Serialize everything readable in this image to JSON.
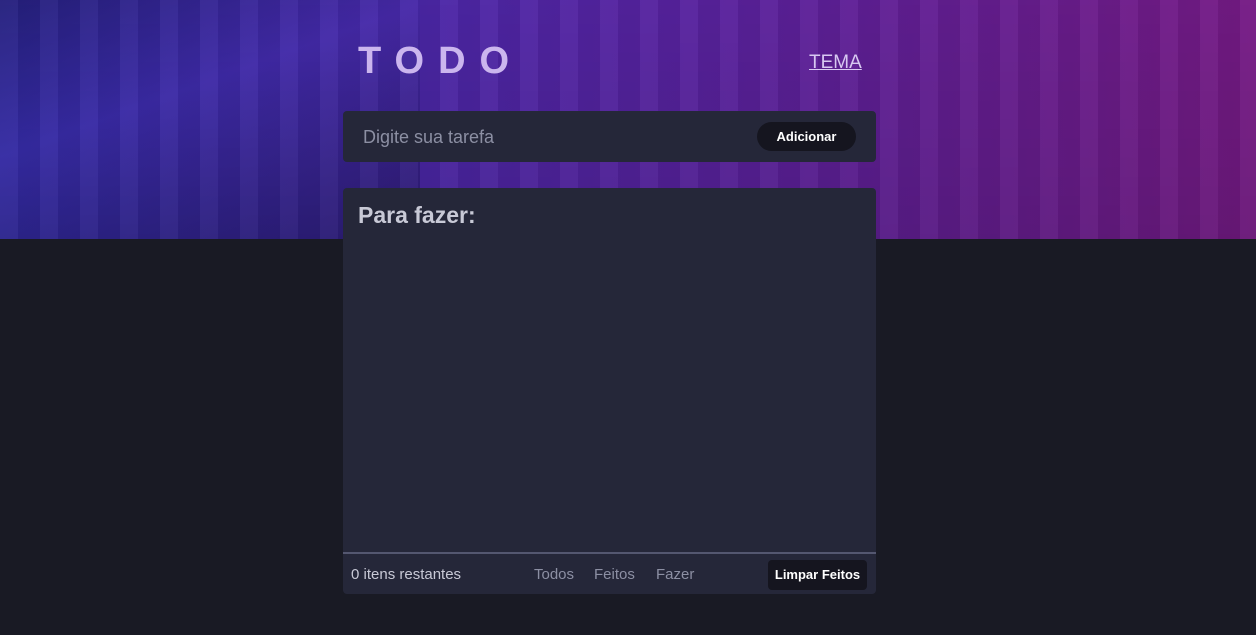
{
  "header": {
    "title": "TODO",
    "theme_link": "TEMA"
  },
  "new_task": {
    "placeholder": "Digite sua tarefa",
    "value": "",
    "add_label": "Adicionar"
  },
  "list": {
    "heading": "Para fazer:",
    "items": []
  },
  "footer": {
    "items_left": "0 itens restantes",
    "filters": [
      "Todos",
      "Feitos",
      "Fazer"
    ],
    "clear_label": "Limpar Feitos"
  },
  "colors": {
    "page_bg": "#191a24",
    "card_bg": "#252739",
    "button_bg": "#15151f",
    "title": "#cbb6ee",
    "gradient_start": "#3a2fb6",
    "gradient_end": "#7b1c8b"
  }
}
